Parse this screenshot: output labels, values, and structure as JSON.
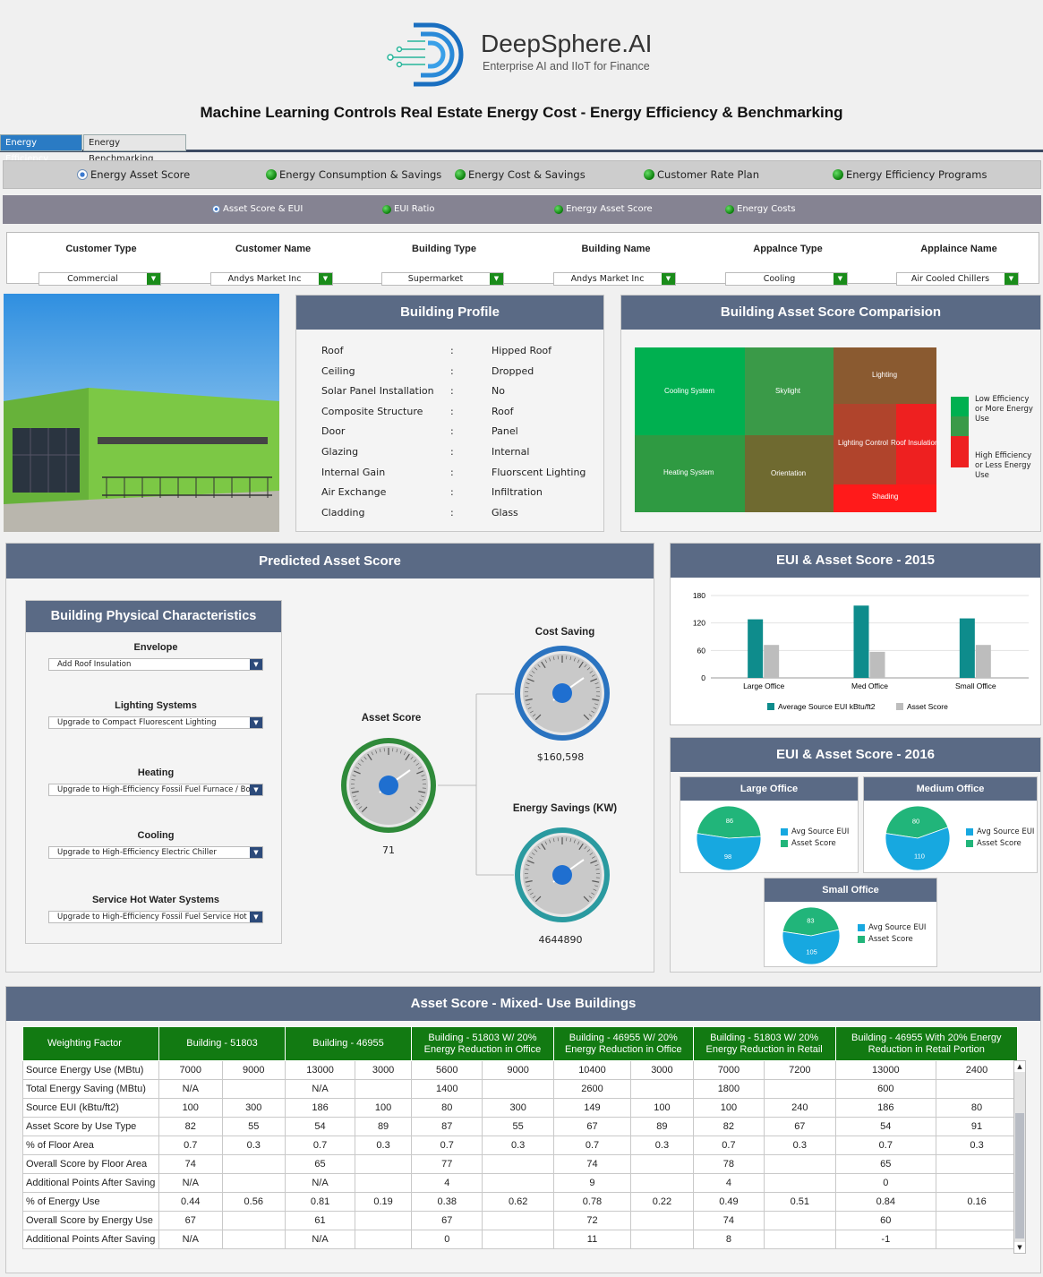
{
  "logo": {
    "brand": "DeepSphere.AI",
    "tagline": "Enterprise AI and IIoT for Finance"
  },
  "page_title": "Machine Learning Controls Real Estate Energy Cost - Energy Efficiency & Benchmarking",
  "tabs": [
    "Energy Efficiency",
    "Energy Benchmarking"
  ],
  "nav1": [
    "Energy Asset Score",
    "Energy Consumption & Savings",
    "Energy Cost & Savings",
    "Customer Rate Plan",
    "Energy Efficiency Programs"
  ],
  "nav2": [
    "Asset Score & EUI",
    "EUI Ratio",
    "Energy Asset Score",
    "Energy Costs"
  ],
  "filters": [
    {
      "label": "Customer Type",
      "value": "Commercial"
    },
    {
      "label": "Customer  Name",
      "value": "Andys Market Inc"
    },
    {
      "label": "Building Type",
      "value": "Supermarket"
    },
    {
      "label": "Building Name",
      "value": "Andys Market Inc"
    },
    {
      "label": "Appalnce Type",
      "value": "Cooling"
    },
    {
      "label": "Applaince Name",
      "value": "Air Cooled Chillers"
    }
  ],
  "building_profile": {
    "title": "Building Profile",
    "sep": ":",
    "rows": [
      {
        "k": "Roof",
        "v": "Hipped Roof"
      },
      {
        "k": "Ceiling",
        "v": "Dropped"
      },
      {
        "k": "Solar Panel Installation",
        "v": "No"
      },
      {
        "k": "Composite Structure",
        "v": "Roof"
      },
      {
        "k": "Door",
        "v": "Panel"
      },
      {
        "k": "Glazing",
        "v": "Internal"
      },
      {
        "k": "Internal Gain",
        "v": "Fluorscent Lighting"
      },
      {
        "k": "Air Exchange",
        "v": "Infiltration"
      },
      {
        "k": "Cladding",
        "v": "Glass"
      }
    ]
  },
  "asset_comparison": {
    "title": "Building Asset Score Comparision",
    "cells": [
      "Cooling System",
      "Skylight",
      "Lighting",
      "Heating System",
      "Orientation",
      "Lighting Control",
      "Roof Insulation",
      "Shading"
    ],
    "legend_low": "Low Efficiency or More Energy Use",
    "legend_high": "High Efficiency or Less Energy Use",
    "colors": {
      "green": "#00b050",
      "mid": "#3a9a48",
      "brown": "#8a5a30",
      "red": "#ee2020"
    }
  },
  "predicted": {
    "title": "Predicted Asset Score",
    "chars_title": "Building Physical Characteristics",
    "chars": [
      {
        "label": "Envelope",
        "value": "Add Roof Insulation"
      },
      {
        "label": "Lighting Systems",
        "value": "Upgrade to Compact Fluorescent Lighting"
      },
      {
        "label": "Heating",
        "value": "Upgrade to High-Efficiency Fossil Fuel Furnace / Boi"
      },
      {
        "label": "Cooling",
        "value": "Upgrade to High-Efficiency Electric Chiller"
      },
      {
        "label": "Service Hot Water Systems",
        "value": "Upgrade to High-Efficiency Fossil Fuel Service Hot W"
      }
    ],
    "gauges": [
      {
        "label": "Asset Score",
        "value": "71"
      },
      {
        "label": "Cost Saving",
        "value": "$160,598"
      },
      {
        "label": "Energy Savings (KW)",
        "value": "4644890"
      }
    ]
  },
  "chart_data": [
    {
      "type": "bar",
      "title": "EUI &  Asset Score - 2015",
      "categories": [
        "Large Office",
        "Med Office",
        "Small Office"
      ],
      "ylim": [
        0,
        180
      ],
      "yticks": [
        "180",
        "120",
        "60",
        "0"
      ],
      "series": [
        {
          "name": "Average Source EUI kBtu/ft2",
          "values": [
            128,
            158,
            130
          ],
          "color": "#0e8c8c"
        },
        {
          "name": "Asset Score",
          "values": [
            72,
            57,
            72
          ],
          "color": "#bdbdbd"
        }
      ]
    },
    {
      "type": "pie",
      "title": "EUI &  Asset Score - 2016",
      "groups": [
        {
          "name": "Large Office",
          "values": [
            98,
            86
          ]
        },
        {
          "name": "Medium Office",
          "values": [
            110,
            80
          ]
        },
        {
          "name": "Small Office",
          "values": [
            105,
            83
          ]
        }
      ],
      "labels": [
        "Avg Source EUI",
        "Asset Score"
      ],
      "colors": [
        "#17a8e0",
        "#21b57a"
      ]
    }
  ],
  "table": {
    "title": "Asset Score - Mixed- Use Buildings",
    "headers": [
      "Weighting Factor",
      "Building - 51803",
      "Building - 46955",
      "Building - 51803 W/ 20% Energy Reduction in Office",
      "Building - 46955 W/ 20% Energy Reduction in Office",
      "Building - 51803 W/ 20% Energy Reduction in Retail",
      "Building - 46955 With 20% Energy Reduction in Retail Portion"
    ],
    "rows": [
      [
        "Source Energy Use (MBtu)",
        "7000",
        "9000",
        "13000",
        "3000",
        "5600",
        "9000",
        "10400",
        "3000",
        "7000",
        "7200",
        "13000",
        "2400"
      ],
      [
        "Total Energy Saving (MBtu)",
        "N/A",
        "",
        "N/A",
        "",
        "1400",
        "",
        "2600",
        "",
        "1800",
        "",
        "600",
        ""
      ],
      [
        "Source EUI (kBtu/ft2)",
        "100",
        "300",
        "186",
        "100",
        "80",
        "300",
        "149",
        "100",
        "100",
        "240",
        "186",
        "80"
      ],
      [
        "Asset Score by Use Type",
        "82",
        "55",
        "54",
        "89",
        "87",
        "55",
        "67",
        "89",
        "82",
        "67",
        "54",
        "91"
      ],
      [
        "% of Floor Area",
        "0.7",
        "0.3",
        "0.7",
        "0.3",
        "0.7",
        "0.3",
        "0.7",
        "0.3",
        "0.7",
        "0.3",
        "0.7",
        "0.3"
      ],
      [
        "Overall Score by Floor Area",
        "74",
        "",
        "65",
        "",
        "77",
        "",
        "74",
        "",
        "78",
        "",
        "65",
        ""
      ],
      [
        "Additional Points After Saving",
        "N/A",
        "",
        "N/A",
        "",
        "4",
        "",
        "9",
        "",
        "4",
        "",
        "0",
        ""
      ],
      [
        "% of Energy Use",
        "0.44",
        "0.56",
        "0.81",
        "0.19",
        "0.38",
        "0.62",
        "0.78",
        "0.22",
        "0.49",
        "0.51",
        "0.84",
        "0.16"
      ],
      [
        "Overall Score by Energy Use",
        "67",
        "",
        "61",
        "",
        "67",
        "",
        "72",
        "",
        "74",
        "",
        "60",
        ""
      ],
      [
        "Additional Points After Saving",
        "N/A",
        "",
        "N/A",
        "",
        "0",
        "",
        "11",
        "",
        "8",
        "",
        "-1",
        ""
      ]
    ]
  }
}
